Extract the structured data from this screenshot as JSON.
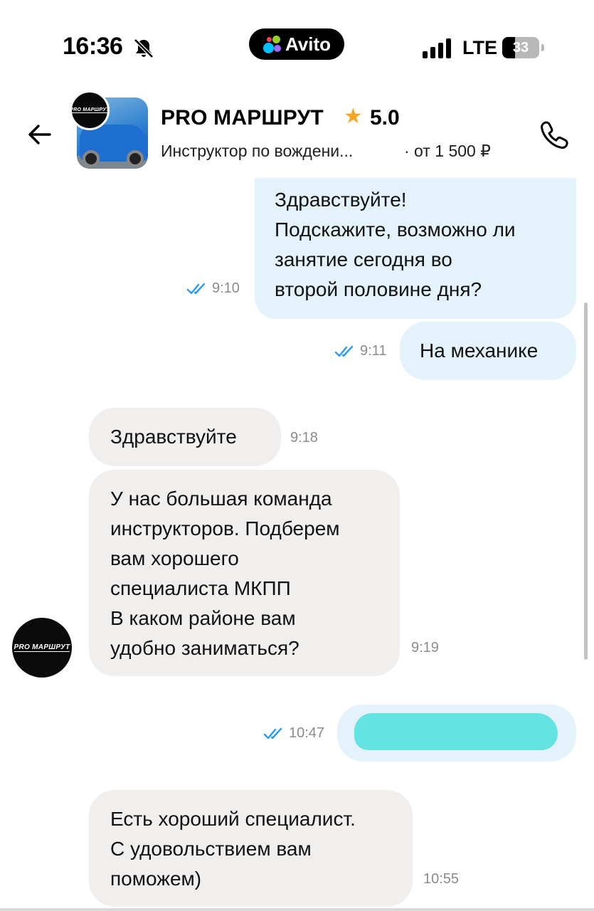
{
  "status_bar": {
    "time": "16:36",
    "carrier_app": "Avito",
    "network": "LTE",
    "battery": "33"
  },
  "header": {
    "title": "PRO МАРШРУТ",
    "rating": "5.0",
    "subtitle": "Инструктор по вождени...",
    "price": "· от 1 500 ₽",
    "logo_text": "PRO МАРШРУТ"
  },
  "messages": [
    {
      "id": "m1",
      "direction": "outgoing",
      "lines": [
        "Здравствуйте!",
        "Подскажите, возможно ли",
        "занятие сегодня во",
        "второй половине дня?"
      ],
      "time": "9:10",
      "read": true
    },
    {
      "id": "m2",
      "direction": "outgoing",
      "lines": [
        "На механике"
      ],
      "time": "9:11",
      "read": true
    },
    {
      "id": "m3",
      "direction": "incoming",
      "lines": [
        "Здравствуйте"
      ],
      "time": "9:18"
    },
    {
      "id": "m4",
      "direction": "incoming",
      "lines": [
        "У нас большая команда",
        "инструкторов. Подберем",
        "вам хорошего",
        "специалиста МКПП",
        "В каком районе вам",
        "удобно заниматься?"
      ],
      "time": "9:19"
    },
    {
      "id": "m5",
      "direction": "outgoing",
      "lines": [
        ""
      ],
      "time": "10:47",
      "read": true,
      "redacted": true
    },
    {
      "id": "m6",
      "direction": "incoming",
      "lines": [
        "Есть хороший специалист.",
        "С удовольствием вам",
        "поможем)"
      ],
      "time": "10:55"
    }
  ],
  "colors": {
    "outgoing_bubble": "#e3f2fb",
    "incoming_bubble": "#f0efed",
    "read_tick": "#2a9bf0",
    "rating_star": "#f5a623",
    "redaction": "#63e3e1"
  },
  "icons": [
    "bell-slash-icon",
    "back-arrow-icon",
    "star-icon",
    "phone-icon",
    "double-check-icon",
    "signal-icon",
    "battery-icon"
  ]
}
